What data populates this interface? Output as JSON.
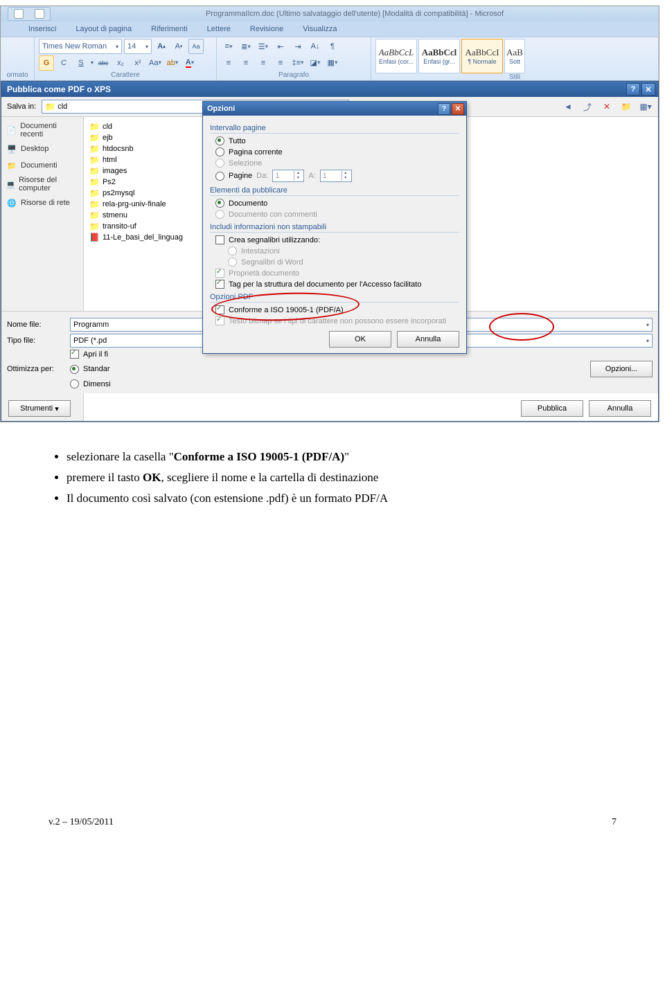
{
  "app": {
    "title": "ProgrammaIIcm.doc (Ultimo salvataggio dell'utente) [Modalità di compatibilità] - Microsof"
  },
  "ribbonTabs": [
    "Inserisci",
    "Layout di pagina",
    "Riferimenti",
    "Lettere",
    "Revisione",
    "Visualizza"
  ],
  "ribbon": {
    "clipboard_label": "ormato",
    "font_name": "Times New Roman",
    "font_size": "14",
    "bold": "G",
    "italic": "C",
    "underline": "S",
    "strike": "abc",
    "sub": "x₂",
    "sup": "x²",
    "aa": "Aa",
    "font_group_label": "Carattere",
    "para_group_label": "Paragrafo",
    "style1": {
      "preview": "AaBbCcL",
      "name": "Enfasi (cor..."
    },
    "style2": {
      "preview": "AaBbCcl",
      "name": "Enfasi (gr..."
    },
    "style3": {
      "preview": "AaBbCcI",
      "name": "¶ Normale"
    },
    "style4": {
      "preview": "AaB",
      "name": "Sott"
    },
    "styles_group_label": "Stili"
  },
  "publishDialog": {
    "title": "Pubblica come PDF o XPS",
    "saveIn_label": "Salva in:",
    "saveIn_value": "cld",
    "places": [
      "Documenti recenti",
      "Desktop",
      "Documenti",
      "Risorse del computer",
      "Risorse di rete"
    ],
    "files": [
      {
        "type": "folder",
        "name": "cld"
      },
      {
        "type": "folder",
        "name": "ejb"
      },
      {
        "type": "folder",
        "name": "htdocsnb"
      },
      {
        "type": "folder",
        "name": "html"
      },
      {
        "type": "folder",
        "name": "images"
      },
      {
        "type": "folder",
        "name": "Ps2"
      },
      {
        "type": "folder",
        "name": "ps2mysql"
      },
      {
        "type": "folder",
        "name": "rela-prg-univ-finale"
      },
      {
        "type": "folder",
        "name": "stmenu"
      },
      {
        "type": "folder",
        "name": "transito-uf"
      },
      {
        "type": "pdf",
        "name": "11-Le_basi_del_linguag"
      }
    ],
    "filename_label": "Nome file:",
    "filename_value": "Programm",
    "filetype_label": "Tipo file:",
    "filetype_value": "PDF (*.pd",
    "openafter": "Apri il fi",
    "optimize_label": "Ottimizza per:",
    "optimize_standard": "Standar",
    "optimize_minsize": "Dimensi",
    "opzioni_btn": "Opzioni...",
    "tools": "Strumenti",
    "publish": "Pubblica",
    "cancel": "Annulla"
  },
  "optionsDialog": {
    "title": "Opzioni",
    "sec_range": "Intervallo pagine",
    "opt_all": "Tutto",
    "opt_current": "Pagina corrente",
    "opt_selection": "Selezione",
    "opt_pages": "Pagine",
    "from": "Da:",
    "to": "A:",
    "from_v": "1",
    "to_v": "1",
    "sec_publish": "Elementi da pubblicare",
    "opt_doc": "Documento",
    "opt_doc_comments": "Documento con commenti",
    "sec_nonprint": "Includi informazioni non stampabili",
    "chk_bookmarks": "Crea segnalibri utilizzando:",
    "radio_headings": "Intestazioni",
    "radio_wordbm": "Segnalibri di Word",
    "chk_docprops": "Proprietà documento",
    "chk_tags": "Tag per la struttura del documento per l'Accesso facilitato",
    "sec_pdf": "Opzioni PDF",
    "chk_iso": "Conforme a ISO 19005-1 (PDF/A)",
    "chk_bitmap": "Testo bitmap se i tipi di carattere non possono essere incorporati",
    "ok": "OK",
    "cancel": "Annulla"
  },
  "docText": {
    "li1_pre": "selezionare la casella \"",
    "li1_strong": "Conforme a ISO 19005-1 (PDF/A)",
    "li1_post": "\"",
    "li2_pre": "premere il tasto ",
    "li2_strong": "OK",
    "li2_post": ", scegliere il nome e la cartella di destinazione",
    "li3": "Il documento così salvato (con estensione .pdf) è un formato PDF/A"
  },
  "footer": {
    "left": "v.2 – 19/05/2011",
    "right": "7"
  }
}
